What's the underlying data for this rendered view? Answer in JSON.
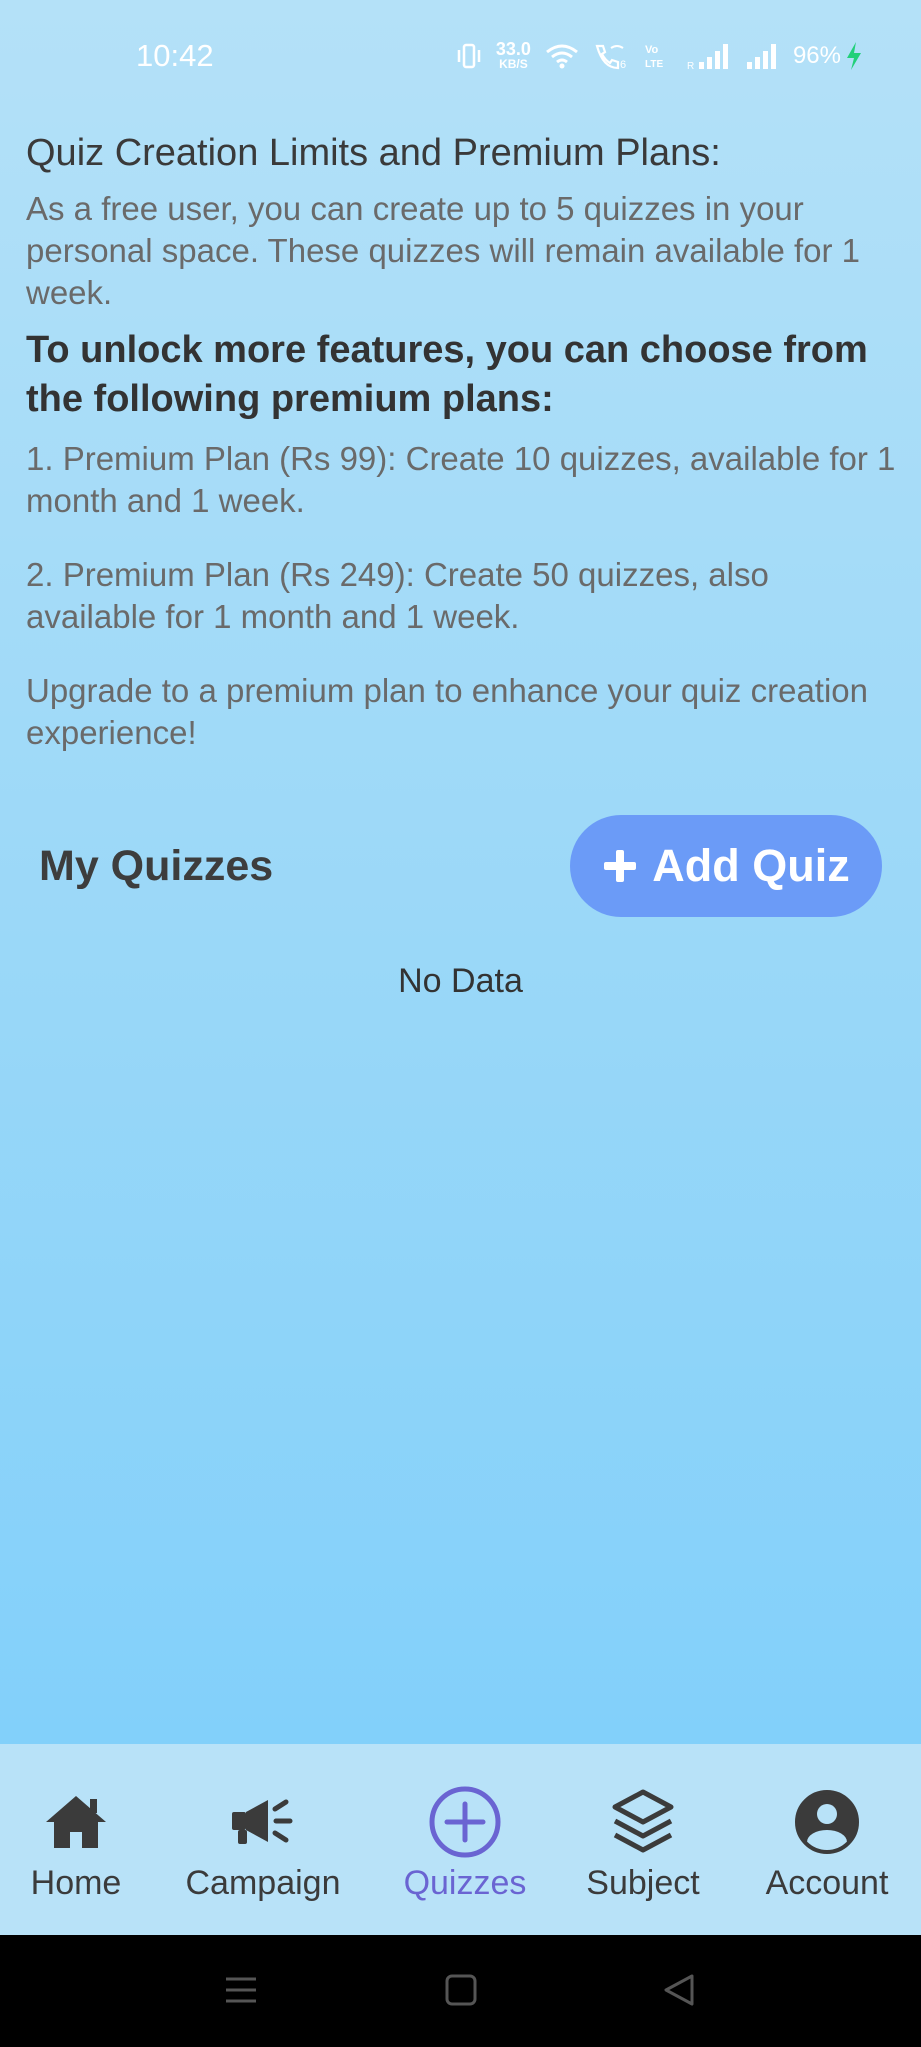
{
  "status_bar": {
    "time": "10:42",
    "net_speed_value": "33.0",
    "net_speed_unit": "KB/S",
    "battery": "96%",
    "icons": [
      "vibrate-icon",
      "wifi-icon",
      "wifi-calling-icon",
      "volte-icon",
      "signal-icon",
      "signal-icon",
      "charging-icon"
    ]
  },
  "info": {
    "title": "Quiz Creation Limits and Premium Plans:",
    "free_text": "As a free user, you can create up to 5 quizzes in your personal space. These quizzes will remain available for 1 week.",
    "unlock_title": "To unlock more features, you can choose from the following premium plans:",
    "plan1": "1. Premium Plan (Rs 99): Create 10 quizzes, available for 1 month and 1 week.",
    "plan2": "2. Premium Plan (Rs 249): Create 50 quizzes, also available for 1 month and 1 week.",
    "upgrade_text": "Upgrade to a premium plan to enhance your quiz creation experience!"
  },
  "quizzes": {
    "title": "My Quizzes",
    "add_button_label": "Add Quiz",
    "empty_text": "No Data"
  },
  "bottom_nav": {
    "items": [
      {
        "label": "Home",
        "icon": "home-icon"
      },
      {
        "label": "Campaign",
        "icon": "megaphone-icon"
      },
      {
        "label": "Quizzes",
        "icon": "add-circle-icon"
      },
      {
        "label": "Subject",
        "icon": "layers-icon"
      },
      {
        "label": "Account",
        "icon": "account-circle-icon"
      }
    ],
    "active_index": 2
  },
  "colors": {
    "accent": "#6b9bf7",
    "active_nav": "#6a64d2",
    "charging": "#22d07a"
  }
}
